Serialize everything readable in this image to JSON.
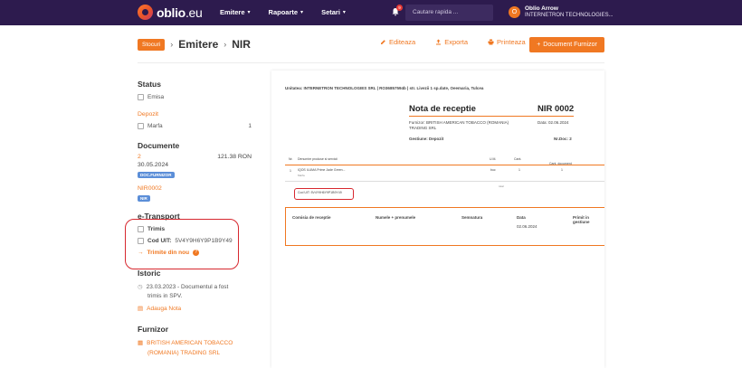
{
  "topbar": {
    "logo_main": "oblio",
    "logo_suffix": ".eu",
    "nav": [
      {
        "label": "Emitere"
      },
      {
        "label": "Rapoarte"
      },
      {
        "label": "Setari"
      }
    ],
    "notification_count": "9",
    "search_placeholder": "Cautare rapida ...",
    "user_initial": "O",
    "user_name": "Oblio Arrow",
    "user_company": "INTERNETRON TECHNOLOGIES..."
  },
  "header": {
    "badge": "Stocuri",
    "crumb1": "Emitere",
    "crumb2": "NIR",
    "actions": [
      {
        "label": "Editeaza",
        "icon": "edit-icon"
      },
      {
        "label": "Exporta",
        "icon": "export-icon"
      },
      {
        "label": "Printeaza",
        "icon": "print-icon"
      }
    ],
    "primary_button": "Document Furnizor"
  },
  "left": {
    "status_title": "Status",
    "status_value": "Emisa",
    "depozit_label": "Depozit",
    "marfa_label": "Marfa",
    "marfa_count": "1",
    "documente_title": "Documente",
    "doc_number": "2",
    "doc_amount": "121.38 RON",
    "doc_date": "30.05.2024",
    "doc_badge": "DOC.FURNIZOR",
    "nir_label": "NIR0002",
    "nir_badge": "NIR",
    "etransport_title": "e-Transport",
    "etransport_status": "Trimis",
    "cod_uit_label": "Cod UIT:",
    "cod_uit_value": "5V4Y9H6Y9P1B9Y49",
    "resend_label": "Trimite din nou",
    "istoric_title": "Istoric",
    "istoric_entry_line1": "23.03.2023 - Documentul a fost",
    "istoric_entry_line2": "trimis in SPV.",
    "add_note": "Adauga Nota",
    "furnizor_title": "Furnizor",
    "furnizor_line1": "BRITISH AMERICAN TOBACCO",
    "furnizor_line2": "(ROMANIA) TRADING SRL"
  },
  "doc": {
    "unit_line": "Unitatea: INTERNETRON TECHNOLOGIES SRL | RO36857594b | str. Livezii 1 sp.date, Oeemaria, Tulcea",
    "title": "Nota de receptie",
    "number": "NIR 0002",
    "furnizor_line": "Furnizor: BRITISH AMERICAN TOBACCO (ROMANIA)",
    "furnizor_line2": "TRADING SRL",
    "data_label": "Data: 02.06.2024",
    "gestiune": "Gestiune: Depozit",
    "nrdoc": "Nr.Doc: 2",
    "col_nr": "Nr.",
    "col_denumire": "Denumire produse si servicii",
    "col_um": "U.M.",
    "col_cant": "Cant.",
    "col_cantdoc": "Cant. document",
    "row_nr": "1",
    "row_name": "IQOS ILUMA Prime Jade Green...",
    "row_sub": "Marfa",
    "row_um": "buc",
    "row_cant": "1",
    "row_cant2": "1",
    "row_total_label": "total",
    "uit_line": "Cod UIT: 5V4Y9H6Y9P1B9Y49",
    "sig_comisia": "Comisia de receptie",
    "sig_nume": "Numele + prenumele",
    "sig_semnatura": "Semnatura",
    "sig_data": "Data",
    "sig_primit": "Primit in gestiune",
    "sig_date_value": "02.06.2024"
  }
}
